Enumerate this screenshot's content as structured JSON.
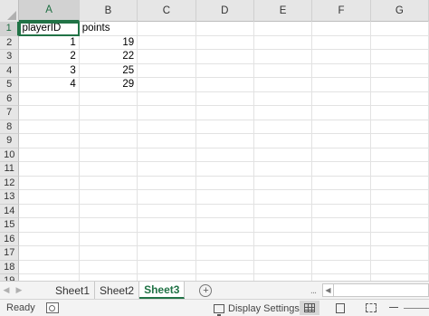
{
  "columns": [
    "A",
    "B",
    "C",
    "D",
    "E",
    "F",
    "G"
  ],
  "row_numbers": [
    "1",
    "2",
    "3",
    "4",
    "5",
    "6",
    "7",
    "8",
    "9",
    "10",
    "11",
    "12",
    "13",
    "14",
    "15",
    "16",
    "17",
    "18",
    "19"
  ],
  "cells": {
    "header": [
      "playerID",
      "points"
    ],
    "data": [
      [
        "1",
        "19"
      ],
      [
        "2",
        "22"
      ],
      [
        "3",
        "25"
      ],
      [
        "4",
        "29"
      ]
    ]
  },
  "sheet_tabs": [
    "Sheet1",
    "Sheet2",
    "Sheet3"
  ],
  "active_sheet": "Sheet3",
  "add_sheet_symbol": "+",
  "status": {
    "ready": "Ready",
    "display_settings": "Display Settings",
    "more_dots": "..."
  },
  "icons": {
    "nav_prev": "◀",
    "nav_next": "▶",
    "hscroll_left": "◀",
    "macro": "macro-recording-icon",
    "display": "display-settings-icon",
    "normal_view": "normal-view-icon",
    "page_layout": "page-layout-icon",
    "page_break": "page-break-preview-icon"
  },
  "colors": {
    "accent": "#217346"
  }
}
